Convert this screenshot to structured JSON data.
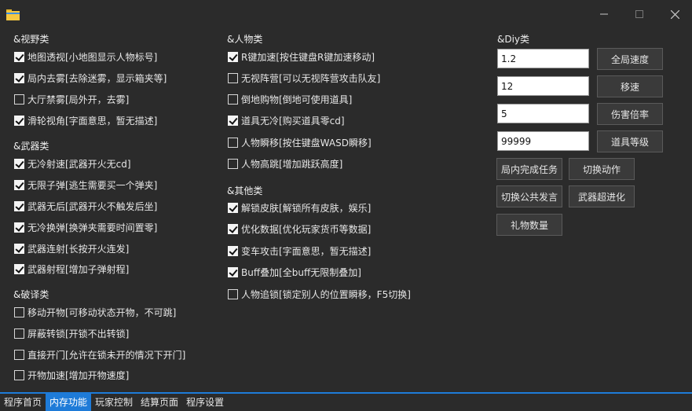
{
  "window": {
    "icon": "folder-icon",
    "controls": [
      "minimize-icon",
      "maximize-icon",
      "close-icon"
    ]
  },
  "vision": {
    "title": "&视野类",
    "items": [
      {
        "label": "地图透视[小地图显示人物标号]",
        "checked": true
      },
      {
        "label": "局内去雾[去除迷雾，显示箱夹等]",
        "checked": true
      },
      {
        "label": "大厅禁雾[局外开，去雾]",
        "checked": false
      },
      {
        "label": "滑轮视角[字面意思，暂无描述]",
        "checked": true
      }
    ]
  },
  "weapon": {
    "title": "&武器类",
    "items": [
      {
        "label": "无冷射速[武器开火无cd]",
        "checked": true
      },
      {
        "label": "无限子弹[逃生需要买一个弹夹]",
        "checked": true
      },
      {
        "label": "武器无后[武器开火不触发后坐]",
        "checked": true
      },
      {
        "label": "无冷换弹[换弹夹需要时间置零]",
        "checked": true
      },
      {
        "label": "武器连射[长按开火连发]",
        "checked": true
      },
      {
        "label": "武器射程[增加子弹射程]",
        "checked": true
      }
    ]
  },
  "breach": {
    "title": "&破译类",
    "items": [
      {
        "label": "移动开物[可移动状态开物，不可跳]",
        "checked": false
      },
      {
        "label": "屏蔽转锁[开锁不出转锁]",
        "checked": false
      },
      {
        "label": "直接开门[允许在锁未开的情况下开门]",
        "checked": false
      },
      {
        "label": "开物加速[增加开物速度]",
        "checked": false
      }
    ]
  },
  "character": {
    "title": "&人物类",
    "items": [
      {
        "label": "R键加速[按住键盘R键加速移动]",
        "checked": true
      },
      {
        "label": "无视阵营[可以无视阵营攻击队友]",
        "checked": false
      },
      {
        "label": "倒地购物[倒地可使用道具]",
        "checked": false
      },
      {
        "label": "道具无冷[购买道具零cd]",
        "checked": true
      },
      {
        "label": "人物瞬移[按住键盘WASD瞬移]",
        "checked": false
      },
      {
        "label": "人物高跳[增加跳跃高度]",
        "checked": false
      }
    ]
  },
  "other": {
    "title": "&其他类",
    "items": [
      {
        "label": "解锁皮肤[解锁所有皮肤，娱乐]",
        "checked": true
      },
      {
        "label": "优化数据[优化玩家货币等数据]",
        "checked": true
      },
      {
        "label": "变车攻击[字面意思，暂无描述]",
        "checked": true
      },
      {
        "label": "Buff叠加[全buff无限制叠加]",
        "checked": true
      },
      {
        "label": "人物追锁[锁定别人的位置瞬移，F5切换]",
        "checked": false
      }
    ]
  },
  "diy": {
    "title": "&Diy类",
    "rows": [
      {
        "value": "1.2",
        "button": "全局速度"
      },
      {
        "value": "12",
        "button": "移速"
      },
      {
        "value": "5",
        "button": "伤害倍率"
      },
      {
        "value": "99999",
        "button": "道具等级"
      }
    ],
    "buttons": {
      "finish_task": "局内完成任务",
      "switch_action": "切换动作",
      "switch_public": "切换公共发言",
      "weapon_evolve": "武器超进化",
      "gift_count": "礼物数量"
    }
  },
  "tabs": [
    {
      "label": "程序首页",
      "active": false
    },
    {
      "label": "内存功能",
      "active": true
    },
    {
      "label": "玩家控制",
      "active": false
    },
    {
      "label": "结算页面",
      "active": false
    },
    {
      "label": "程序设置",
      "active": false
    }
  ]
}
